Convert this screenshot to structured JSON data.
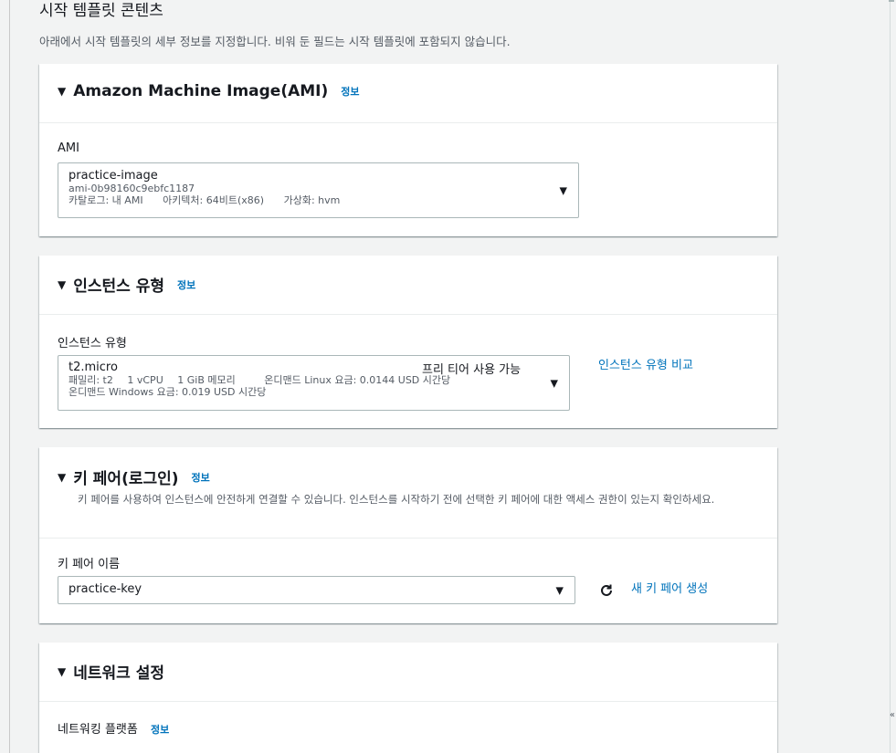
{
  "header": {
    "title": "시작 템플릿 콘텐츠",
    "description": "아래에서 시작 템플릿의 세부 정보를 지정합니다. 비워 둔 필드는 시작 템플릿에 포함되지 않습니다."
  },
  "ami": {
    "title": "Amazon Machine Image(AMI)",
    "info": "정보",
    "field_label": "AMI",
    "selected": {
      "name": "practice-image",
      "id": "ami-0b98160c9ebfc1187",
      "catalog": "카탈로그: 내 AMI",
      "arch": "아키텍처: 64비트(x86)",
      "virt": "가상화: hvm"
    }
  },
  "instance_type": {
    "title": "인스턴스 유형",
    "info": "정보",
    "field_label": "인스턴스 유형",
    "selected": {
      "name": "t2.micro",
      "badge": "프리 티어 사용 가능",
      "family": "패밀리: t2",
      "vcpu": "1 vCPU",
      "memory": "1 GiB 메모리",
      "linux_price": "온디맨드 Linux 요금: 0.0144 USD 시간당",
      "windows_price": "온디맨드 Windows 요금: 0.019 USD 시간당"
    },
    "compare_link": "인스턴스 유형 비교"
  },
  "key_pair": {
    "title": "키 페어(로그인)",
    "info": "정보",
    "description": "키 페어를 사용하여 인스턴스에 안전하게 연결할 수 있습니다. 인스턴스를 시작하기 전에 선택한 키 페어에 대한 액세스 권한이 있는지 확인하세요.",
    "field_label": "키 페어 이름",
    "selected": "practice-key",
    "create_link": "새 키 페어 생성"
  },
  "network": {
    "title": "네트워크 설정",
    "field_label": "네트워킹 플랫폼",
    "info": "정보"
  },
  "glyphs": {
    "caret": "▼",
    "dropdown_arrow": "▼",
    "corner": "«"
  },
  "colors": {
    "link": "#0073bb",
    "text": "#16191f",
    "muted": "#545b64",
    "page_bg": "#f2f3f3"
  },
  "icons": {
    "refresh": "refresh-icon",
    "caret": "caret-down-icon",
    "dropdown": "chevron-down-icon"
  }
}
